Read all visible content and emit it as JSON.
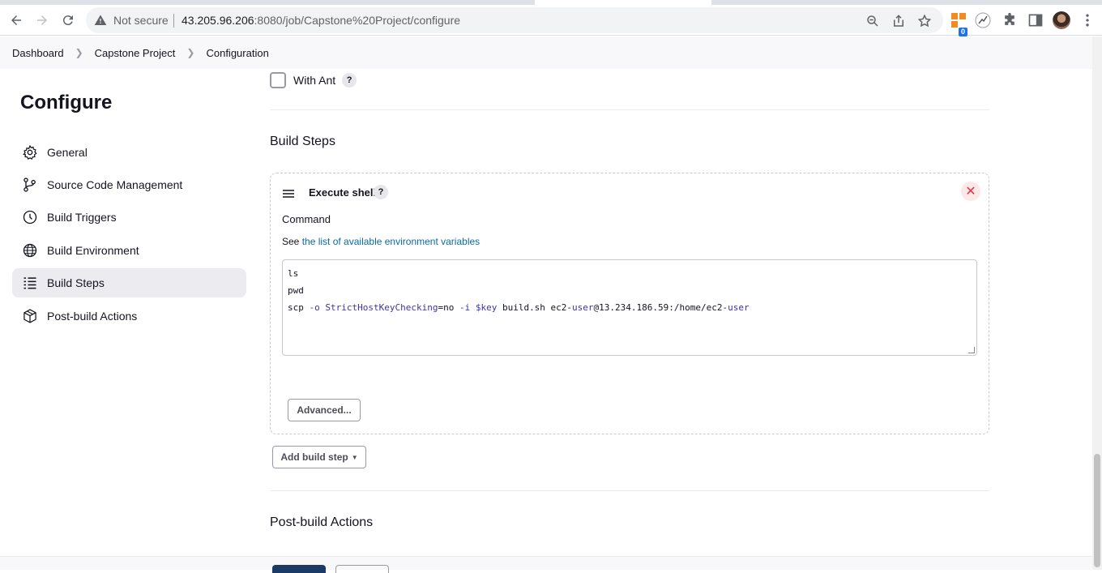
{
  "browser": {
    "security_label": "Not secure",
    "url_host": "43.205.96.206",
    "url_path": ":8080/job/Capstone%20Project/configure",
    "extension_badge": "0"
  },
  "breadcrumbs": [
    "Dashboard",
    "Capstone Project",
    "Configuration"
  ],
  "sidebar": {
    "title": "Configure",
    "items": [
      {
        "label": "General",
        "icon": "gear-icon"
      },
      {
        "label": "Source Code Management",
        "icon": "branch-icon"
      },
      {
        "label": "Build Triggers",
        "icon": "clock-icon"
      },
      {
        "label": "Build Environment",
        "icon": "globe-icon"
      },
      {
        "label": "Build Steps",
        "icon": "list-icon",
        "active": true
      },
      {
        "label": "Post-build Actions",
        "icon": "box-icon"
      }
    ]
  },
  "main": {
    "with_ant_label": "With Ant",
    "help_glyph": "?",
    "build_steps_title": "Build Steps",
    "step": {
      "name": "Execute shell",
      "command_label": "Command",
      "see_prefix": "See",
      "env_link": "the list of available environment variables",
      "command_lines": [
        "ls",
        "pwd",
        "scp -o StrictHostKeyChecking=no -i $key build.sh ec2-user@13.234.186.59:/home/ec2-user"
      ],
      "advanced_label": "Advanced..."
    },
    "add_build_step_label": "Add build step",
    "post_build_title": "Post-build Actions"
  }
}
